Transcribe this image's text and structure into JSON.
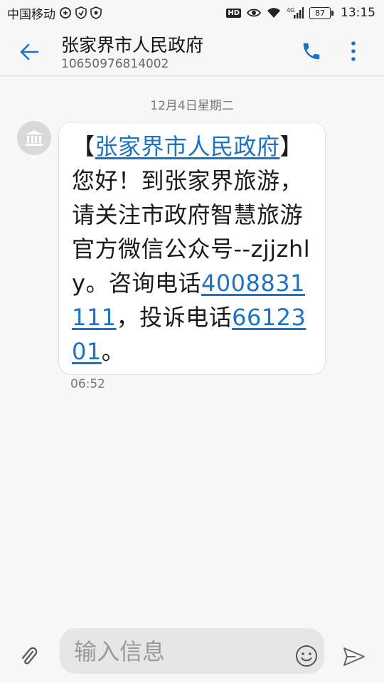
{
  "status_bar": {
    "carrier": "中国移动",
    "hd": "HD",
    "network": "4G",
    "battery": "87",
    "time": "13:15"
  },
  "header": {
    "contact_name": "张家界市人民政府",
    "contact_number": "10650976814002",
    "icons": {
      "back": "back-arrow-icon",
      "call": "phone-icon",
      "more": "more-vertical-icon"
    }
  },
  "conversation": {
    "date": "12月4日星期二",
    "message": {
      "prefix_bracket": "【",
      "sender_link": "张家界市人民政府",
      "text_1": "】您好！到张家界旅游，请关注市政府智慧旅游官方微信公众号--zjjzhly。咨询电话",
      "phone_link_1": "4008831111",
      "text_2": "，投诉电话",
      "phone_link_2": "6612301",
      "text_3": "。",
      "time": "06:52"
    }
  },
  "compose": {
    "placeholder": "输入信息",
    "icons": {
      "attach": "paperclip-icon",
      "emoji": "smiley-icon",
      "send": "send-icon"
    }
  },
  "colors": {
    "accent": "#1a73c7",
    "background": "#f7f7f7",
    "bubble": "#ffffff"
  }
}
